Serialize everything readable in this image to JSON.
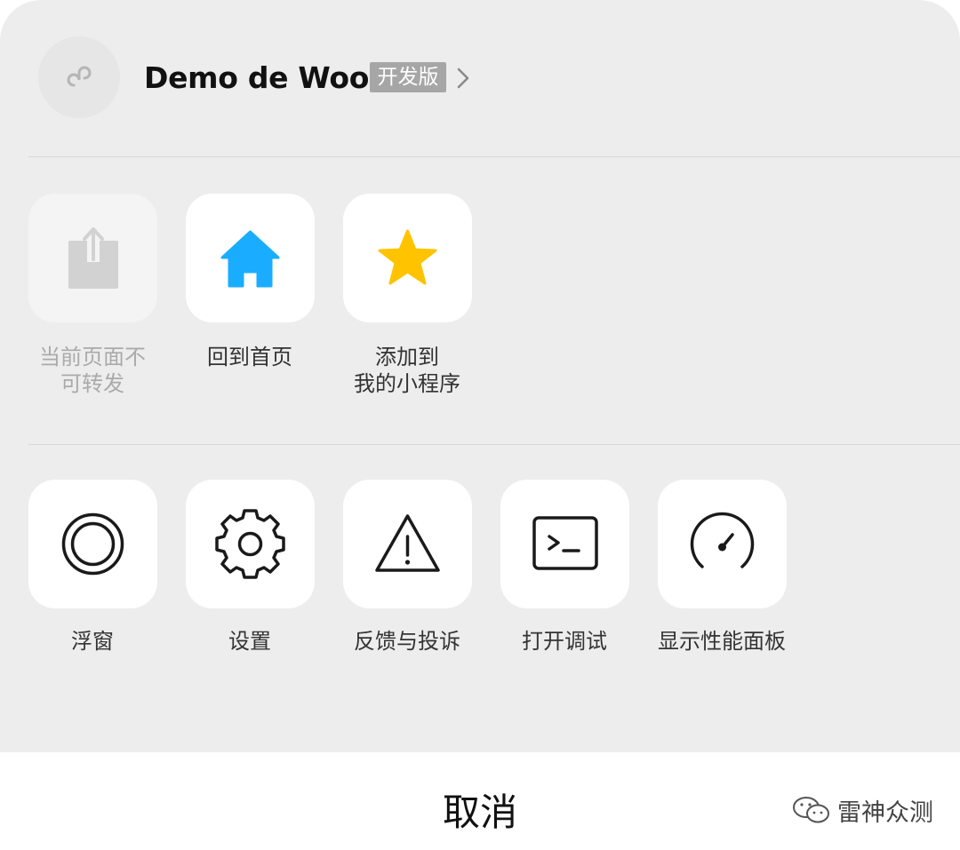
{
  "header": {
    "app_name": "Demo de Woo",
    "badge": "开发版",
    "avatar_icon": "mini-program-link-icon"
  },
  "row1": [
    {
      "label": "当前页面不可转发",
      "label_line1": "当前页面不",
      "label_line2": "可转发",
      "icon": "share-icon",
      "disabled": true
    },
    {
      "label": "回到首页",
      "icon": "home-icon",
      "disabled": false,
      "color": "#1aadff"
    },
    {
      "label": "添加到我的小程序",
      "label_line1": "添加到",
      "label_line2": "我的小程序",
      "icon": "star-icon",
      "disabled": false,
      "color": "#ffc300"
    }
  ],
  "row2": [
    {
      "label": "浮窗",
      "icon": "floating-window-icon"
    },
    {
      "label": "设置",
      "icon": "gear-icon"
    },
    {
      "label": "反馈与投诉",
      "icon": "warning-icon"
    },
    {
      "label": "打开调试",
      "icon": "terminal-icon"
    },
    {
      "label": "显示性能面板",
      "icon": "speedometer-icon"
    }
  ],
  "cancel": "取消",
  "watermark": "雷神众测"
}
